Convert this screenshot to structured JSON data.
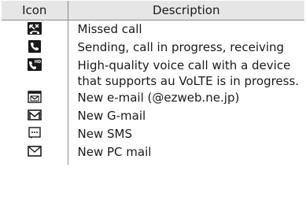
{
  "table": {
    "headers": {
      "icon": "Icon",
      "description": "Description"
    },
    "rows": [
      {
        "icon": "missed-call-icon",
        "description": "Missed call"
      },
      {
        "icon": "call-in-progress-icon",
        "description": "Sending, call in progress, receiving"
      },
      {
        "icon": "hd-volte-call-icon",
        "description": "High-quality voice call with a device that supports au VoLTE is in progress."
      },
      {
        "icon": "ezweb-email-icon",
        "description": "New e-mail (@ezweb.ne.jp)"
      },
      {
        "icon": "gmail-icon",
        "description": "New G-mail"
      },
      {
        "icon": "sms-icon",
        "description": "New SMS"
      },
      {
        "icon": "pc-mail-icon",
        "description": "New PC mail"
      }
    ]
  },
  "colors": {
    "header_background": "#e6e6e6",
    "rule": "#8a8a8a",
    "text": "#1a1a1a"
  }
}
